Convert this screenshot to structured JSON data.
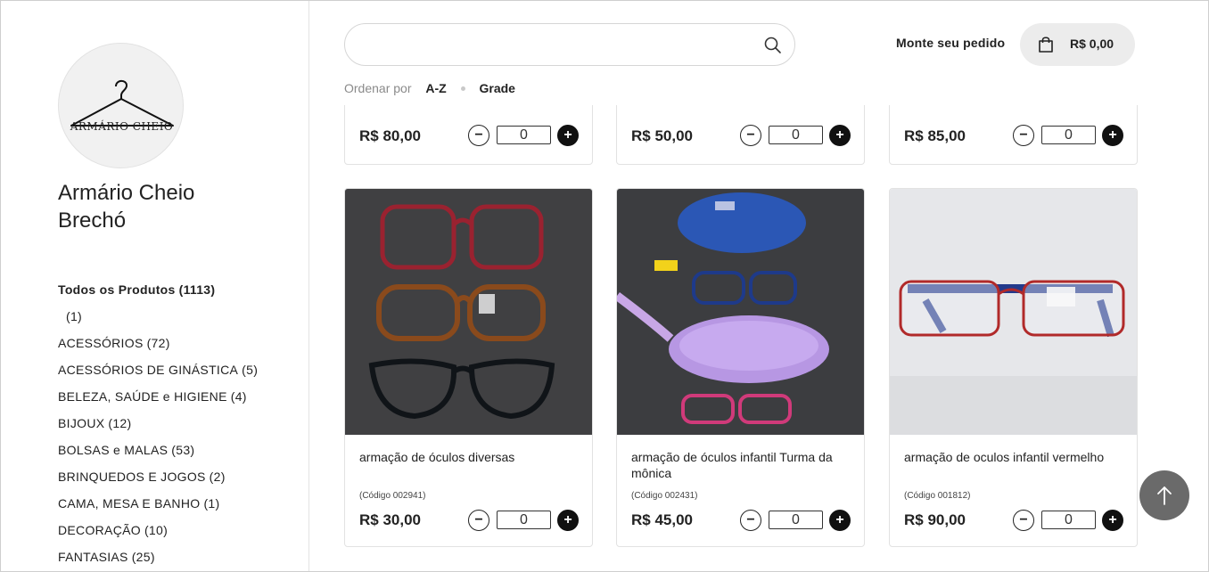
{
  "store": {
    "logo_text": "ARMÁRIO CHEIO",
    "name": "Armário Cheio Brechó"
  },
  "categories": [
    {
      "label": "Todos os Produtos",
      "count": "(1113)",
      "active": true
    },
    {
      "label": "",
      "count": "(1)"
    },
    {
      "label": "ACESSÓRIOS",
      "count": "(72)"
    },
    {
      "label": "ACESSÓRIOS DE GINÁSTICA",
      "count": "(5)"
    },
    {
      "label": "BELEZA, SAÚDE e HIGIENE",
      "count": "(4)"
    },
    {
      "label": "BIJOUX",
      "count": "(12)"
    },
    {
      "label": "BOLSAS e MALAS",
      "count": "(53)"
    },
    {
      "label": "BRINQUEDOS E JOGOS",
      "count": "(2)"
    },
    {
      "label": "CAMA, MESA E BANHO",
      "count": "(1)"
    },
    {
      "label": "DECORAÇÃO",
      "count": "(10)"
    },
    {
      "label": "FANTASIAS",
      "count": "(25)"
    }
  ],
  "header": {
    "search_placeholder": "",
    "order_link": "Monte seu pedido",
    "cart_total": "R$ 0,00"
  },
  "sort": {
    "label": "Ordenar por",
    "order": "A-Z",
    "view": "Grade"
  },
  "products_top": [
    {
      "price": "R$ 80,00",
      "qty": "0"
    },
    {
      "price": "R$ 50,00",
      "qty": "0"
    },
    {
      "price": "R$ 85,00",
      "qty": "0"
    }
  ],
  "products": [
    {
      "title": "armação de óculos diversas",
      "code": "(Código 002941)",
      "price": "R$ 30,00",
      "qty": "0"
    },
    {
      "title": "armação de óculos infantil Turma da mônica",
      "code": "(Código 002431)",
      "price": "R$ 45,00",
      "qty": "0"
    },
    {
      "title": "armação de oculos infantil vermelho",
      "code": "(Código 001812)",
      "price": "R$ 90,00",
      "qty": "0"
    }
  ],
  "qty_buttons": {
    "minus": "−",
    "plus": "+"
  },
  "colors": {
    "accent": "#111111",
    "cart_bg": "#ececec",
    "scroll_btn": "#5a5a5a"
  }
}
